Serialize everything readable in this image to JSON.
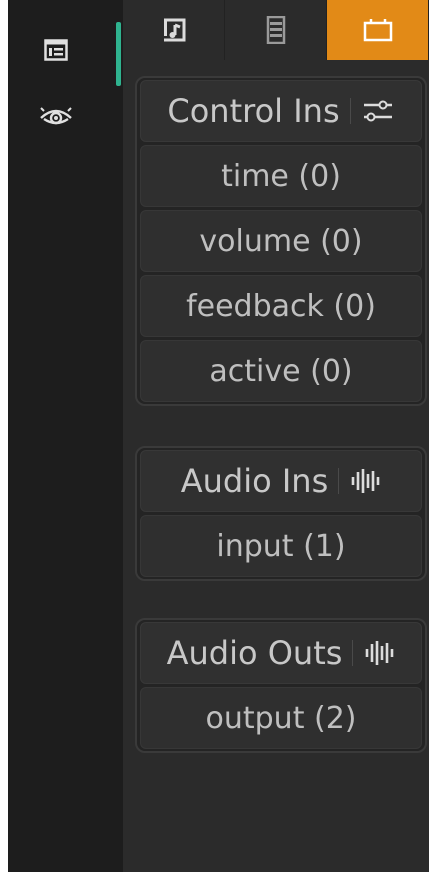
{
  "sidebar": {
    "icons": [
      "panel-list-icon",
      "eye-icon"
    ]
  },
  "tabs": [
    {
      "icon": "music-note-icon",
      "active": false
    },
    {
      "icon": "list-icon",
      "active": false
    },
    {
      "icon": "box-icon",
      "active": true
    }
  ],
  "sections": {
    "control_ins": {
      "title": "Control Ins",
      "icon": "sliders-icon",
      "items": [
        "time (0)",
        "volume (0)",
        "feedback (0)",
        "active (0)"
      ]
    },
    "audio_ins": {
      "title": "Audio Ins",
      "icon": "waveform-icon",
      "items": [
        "input (1)"
      ]
    },
    "audio_outs": {
      "title": "Audio Outs",
      "icon": "waveform-icon",
      "items": [
        "output (2)"
      ]
    }
  },
  "colors": {
    "accent_teal": "#2fb38f",
    "active_tab": "#e28a17"
  }
}
